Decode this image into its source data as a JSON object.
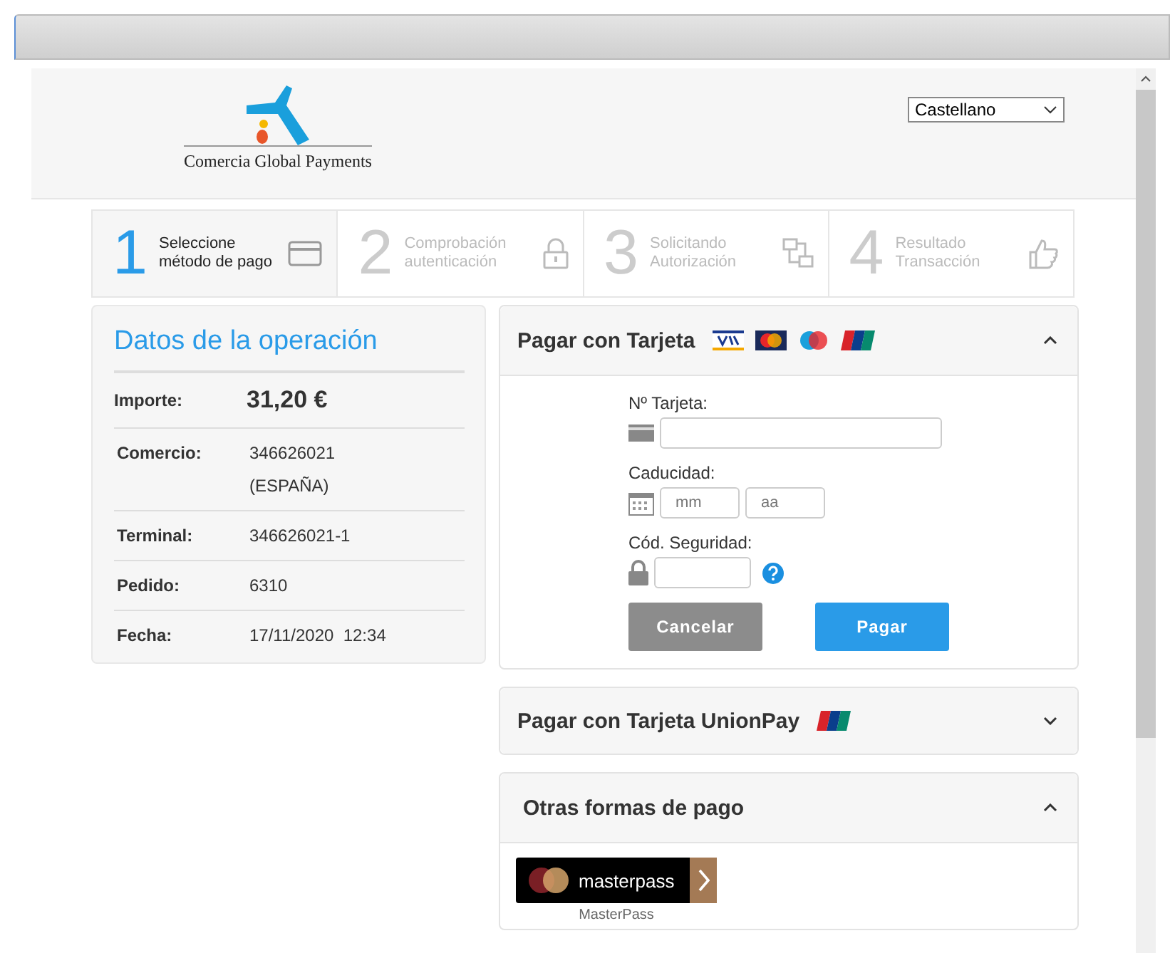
{
  "language_select": {
    "value": "Castellano"
  },
  "logo": {
    "text": "Comercia Global Payments"
  },
  "steps": [
    {
      "number": "1",
      "label": [
        "Seleccione",
        "método de pago"
      ],
      "selected": true,
      "kind": "card"
    },
    {
      "number": "2",
      "label": [
        "Comprobación",
        "autenticación"
      ],
      "selected": false,
      "kind": "lock"
    },
    {
      "number": "3",
      "label": [
        "Solicitando",
        "Autorización"
      ],
      "selected": false,
      "kind": "transfer"
    },
    {
      "number": "4",
      "label": [
        "Resultado",
        "Transacción"
      ],
      "selected": false,
      "kind": "thumb"
    }
  ],
  "operation": {
    "title": "Datos de la operación",
    "rows": [
      {
        "label": "Importe:",
        "lines": [
          "31,20 €"
        ],
        "kind": "amount"
      },
      {
        "label": "Comercio:",
        "lines": [
          "346626021",
          "(ESPAÑA)"
        ],
        "kind": "plain"
      },
      {
        "label": "Terminal:",
        "lines": [
          "346626021-1"
        ],
        "kind": "plain"
      },
      {
        "label": "Pedido:",
        "lines": [
          "6310"
        ],
        "kind": "plain"
      },
      {
        "label": "Fecha:",
        "lines": [
          "17/11/2020  12:34"
        ],
        "kind": "plain"
      }
    ]
  },
  "panels": [
    {
      "title": "Pagar con Tarjeta",
      "expanded": true,
      "kind": "card_form",
      "logos": [
        {
          "kind": "visa"
        },
        {
          "kind": "mastercard"
        },
        {
          "kind": "maestro"
        },
        {
          "kind": "unionpay"
        }
      ],
      "fields": [
        {
          "label": "Nº Tarjeta:",
          "kind": "card"
        },
        {
          "label": "Caducidad:",
          "kind": "expiry",
          "placeholders": [
            "mm",
            "aa"
          ]
        },
        {
          "label": "Cód. Seguridad:",
          "kind": "cvv"
        }
      ],
      "buttons": [
        {
          "label": "Cancelar",
          "kind": "secondary"
        },
        {
          "label": "Pagar",
          "kind": "primary"
        }
      ]
    },
    {
      "title": "Pagar con Tarjeta UnionPay",
      "expanded": false,
      "kind": "unionpay",
      "logos": [
        {
          "kind": "unionpay"
        }
      ]
    },
    {
      "title": "Otras formas de pago",
      "expanded": true,
      "kind": "other",
      "methods": [
        {
          "logo_text": "masterpass",
          "caption": "MasterPass"
        }
      ]
    }
  ]
}
